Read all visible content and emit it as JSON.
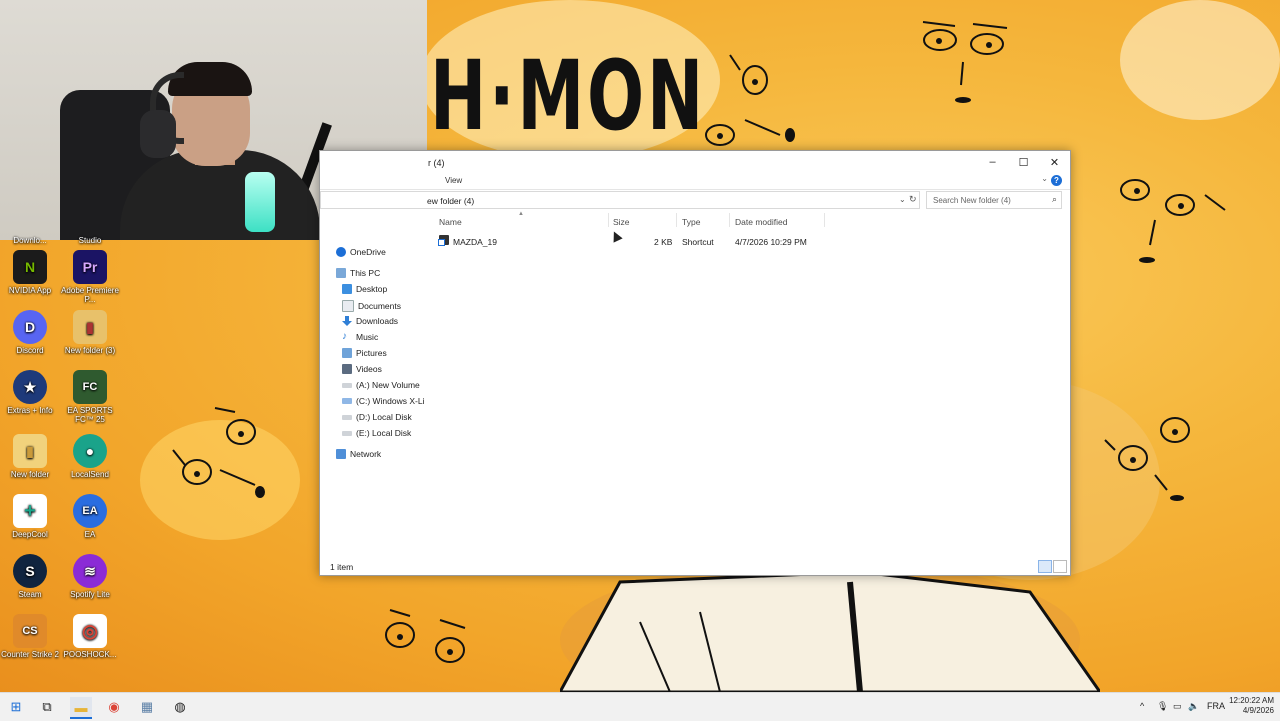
{
  "wallpaper": {
    "headline": "H·MON"
  },
  "explorer": {
    "title": "r (4)",
    "ribbon_tab": "View",
    "address": "ew folder (4)",
    "search_placeholder": "Search New folder (4)",
    "nav": [
      {
        "label": "OneDrive",
        "icon": "cloud-icon"
      },
      {
        "label": "This PC",
        "icon": "computer-icon"
      },
      {
        "label": "Desktop",
        "icon": "folder-icon"
      },
      {
        "label": "Documents",
        "icon": "document-icon"
      },
      {
        "label": "Downloads",
        "icon": "download-icon"
      },
      {
        "label": "Music",
        "icon": "music-icon"
      },
      {
        "label": "Pictures",
        "icon": "picture-icon"
      },
      {
        "label": "Videos",
        "icon": "video-icon"
      },
      {
        "label": "(A:) New Volume",
        "icon": "drive-icon"
      },
      {
        "label": "(C:) Windows X-Li",
        "icon": "drive-icon"
      },
      {
        "label": "(D:) Local Disk",
        "icon": "drive-icon"
      },
      {
        "label": "(E:) Local Disk",
        "icon": "drive-icon"
      },
      {
        "label": "Network",
        "icon": "network-icon"
      }
    ],
    "columns": [
      "Name",
      "Size",
      "Type",
      "Date modified"
    ],
    "files": [
      {
        "name": "MAZDA_19",
        "size": "2 KB",
        "type": "Shortcut",
        "date": "4/7/2026 10:29 PM"
      }
    ],
    "status": "1 item"
  },
  "desktop_icons": [
    {
      "label": "Downlo...",
      "color": "#6b6b6b",
      "glyph": ""
    },
    {
      "label": "Studio",
      "color": "#6b6b6b",
      "glyph": ""
    },
    {
      "label": "NVIDIA App",
      "color": "#1b1b1b",
      "glyph": "N"
    },
    {
      "label": "Adobe Premiere P...",
      "color": "#1b1464",
      "glyph": "Pr"
    },
    {
      "label": "Discord",
      "color": "#5865f2",
      "glyph": "D"
    },
    {
      "label": "New folder (3)",
      "color": "#e8c16a",
      "glyph": "▮"
    },
    {
      "label": "Extras + Info",
      "color": "#1e3a7a",
      "glyph": "★"
    },
    {
      "label": "EA SPORTS FC™ 25",
      "color": "#2f5a2f",
      "glyph": "FC"
    },
    {
      "label": "New folder",
      "color": "#f1d27c",
      "glyph": "▮"
    },
    {
      "label": "LocalSend",
      "color": "#1aa38a",
      "glyph": "●"
    },
    {
      "label": "DeepCool",
      "color": "#ffffff",
      "glyph": "+"
    },
    {
      "label": "EA",
      "color": "#2a6de0",
      "glyph": "EA"
    },
    {
      "label": "Steam",
      "color": "#10243f",
      "glyph": "S"
    },
    {
      "label": "Spotify Lite",
      "color": "#8b2bd6",
      "glyph": "≋"
    },
    {
      "label": "Counter Strike 2",
      "color": "#e08a2a",
      "glyph": "CS"
    },
    {
      "label": "POOSHOCK...",
      "color": "#ffffff",
      "glyph": "◎"
    }
  ],
  "taskbar": {
    "language": "FRA",
    "time": "12:20:22 AM",
    "date": "4/9/2026"
  }
}
